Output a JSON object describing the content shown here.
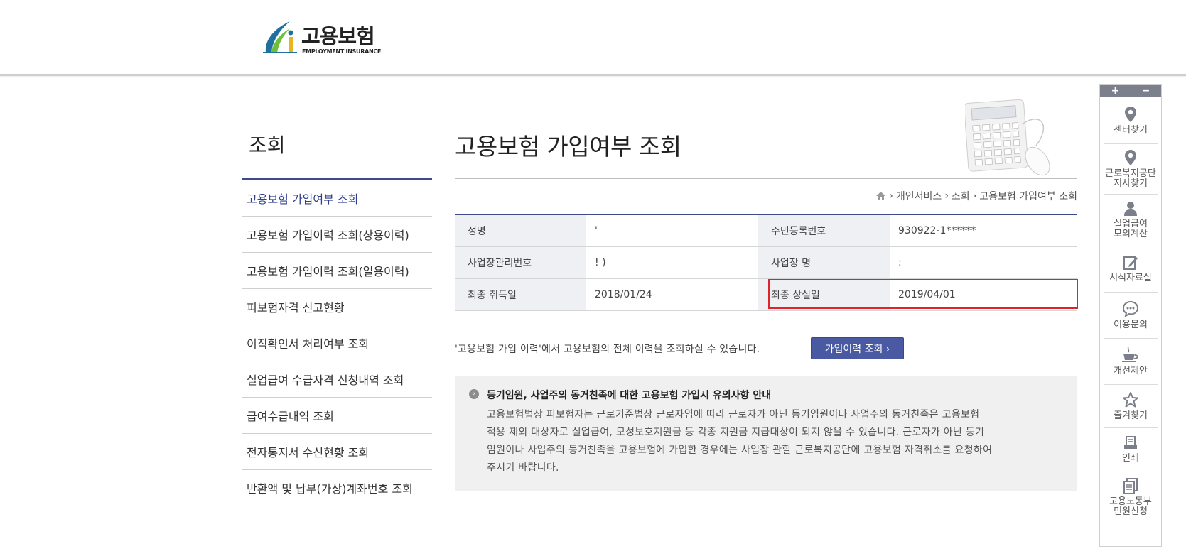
{
  "header": {
    "logo_ko": "고용보험",
    "logo_en": "EMPLOYMENT INSURANCE"
  },
  "sidebar": {
    "title": "조회",
    "items": [
      {
        "label": "고용보험 가입여부 조회",
        "active": true
      },
      {
        "label": "고용보험 가입이력 조회(상용이력)"
      },
      {
        "label": "고용보험 가입이력 조회(일용이력)"
      },
      {
        "label": "피보험자격 신고현황"
      },
      {
        "label": "이직확인서 처리여부 조회"
      },
      {
        "label": "실업급여 수급자격 신청내역 조회"
      },
      {
        "label": "급여수급내역 조회"
      },
      {
        "label": "전자통지서 수신현황 조회"
      },
      {
        "label": "반환액 및 납부(가상)계좌번호 조회"
      }
    ]
  },
  "main": {
    "title": "고용보험 가입여부 조회",
    "breadcrumb": [
      "개인서비스",
      "조회",
      "고용보험 가입여부 조회"
    ],
    "table": {
      "row1": {
        "label1": "성명",
        "value1": "'",
        "label2": "주민등록번호",
        "value2": "930922-1******"
      },
      "row2": {
        "label1": "사업장관리번호",
        "value1": "!                   )",
        "label2": "사업장 명",
        "value2": ":"
      },
      "row3": {
        "label1": "최종 취득일",
        "value1": "2018/01/24",
        "label2": "최종 상실일",
        "value2": "2019/04/01"
      }
    },
    "history_text": "'고용보험 가입 이력'에서 고용보험의 전체 이력을 조회하실 수 있습니다.",
    "history_button": "가입이력 조회 ›",
    "notice": {
      "title": "등기임원, 사업주의 동거친족에 대한 고용보험 가입시 유의사항 안내",
      "lines": [
        "고용보험법상 피보험자는 근로기준법상 근로자임에 따라 근로자가 아닌 등기임원이나 사업주의 동거친족은 고용보험",
        "적용 제외 대상자로 실업급여, 모성보호지원금 등 각종 지원금 지급대상이 되지 않을 수 있습니다. 근로자가 아닌 등기",
        "임원이나 사업주의 동거친족을 고용보험에 가입한 경우에는 사업장 관할 근로복지공단에 고용보험 자격취소를 요청하여",
        "주시기 바랍니다."
      ]
    }
  },
  "quick_menu": {
    "plus": "+",
    "minus": "−",
    "items": [
      {
        "l1": "센터찾기",
        "l2": "",
        "icon": "location-pin-icon"
      },
      {
        "l1": "근로복지공단",
        "l2": "지사찾기",
        "icon": "location-pin-icon"
      },
      {
        "l1": "실업급여",
        "l2": "모의계산",
        "icon": "person-icon"
      },
      {
        "l1": "서식자료실",
        "l2": "",
        "icon": "edit-form-icon"
      },
      {
        "l1": "이용문의",
        "l2": "",
        "icon": "chat-bubble-icon"
      },
      {
        "l1": "개선제안",
        "l2": "",
        "icon": "coffee-cup-icon"
      },
      {
        "l1": "즐겨찾기",
        "l2": "",
        "icon": "star-icon"
      },
      {
        "l1": "인쇄",
        "l2": "",
        "icon": "printer-icon"
      },
      {
        "l1": "고용노동부",
        "l2": "민원신청",
        "icon": "documents-icon"
      }
    ]
  },
  "colors": {
    "accent": "#3e4a8a",
    "button": "#4a5aa2",
    "highlight": "#e0232a",
    "table_header_bg": "#eef0f4",
    "notice_bg": "#f0f0f0"
  }
}
